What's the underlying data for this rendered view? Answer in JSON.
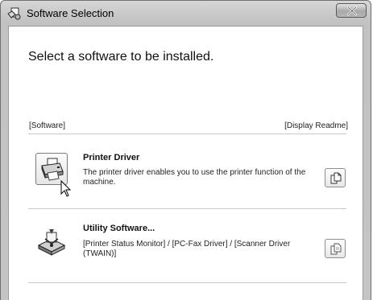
{
  "window": {
    "title": "Software Selection",
    "icon": "setup-icon",
    "close_icon": "close-icon"
  },
  "main": {
    "heading": "Select a software to be installed.",
    "software_label": "[Software]",
    "readme_label": "[Display Readme]"
  },
  "items": [
    {
      "title": "Printer Driver",
      "description": "The printer driver enables you to use the printer function of the machine.",
      "icon": "printer-icon",
      "readme_icon": "document-icon"
    },
    {
      "title": "Utility Software...",
      "description": "[Printer Status Monitor] / [PC-Fax Driver] / [Scanner Driver (TWAIN)]",
      "icon": "utility-icon",
      "readme_icon": "document-icon"
    }
  ],
  "colors": {
    "frame": "#c4c4c4",
    "client": "#ffffff"
  }
}
